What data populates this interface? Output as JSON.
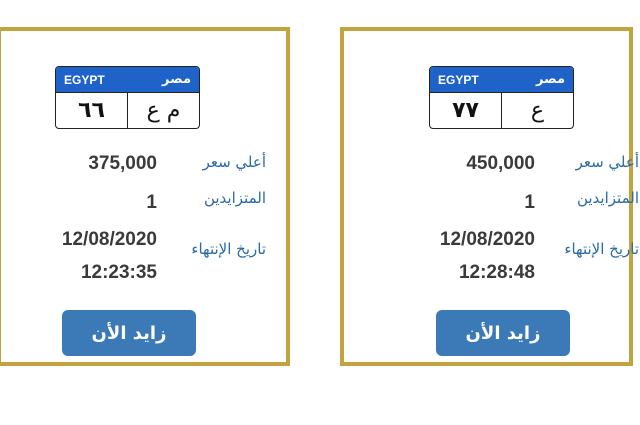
{
  "cards": [
    {
      "plate": {
        "country_en": "EGYPT",
        "country_ar": "مصر",
        "numbers": "٦٦",
        "letters": "م ع"
      },
      "highest_bid_label": "أعلي سعر",
      "highest_bid": "375,000",
      "bidders_label": "المتزايدين",
      "bidders": "1",
      "end_date_label": "تاريخ الإنتهاء",
      "end_date": "12/08/2020",
      "end_time": "12:23:35",
      "bid_button": "زايد الأن"
    },
    {
      "plate": {
        "country_en": "EGYPT",
        "country_ar": "مصر",
        "numbers": "٧٧",
        "letters": "ع"
      },
      "highest_bid_label": "أعلي سعر",
      "highest_bid": "450,000",
      "bidders_label": "المتزايدين",
      "bidders": "1",
      "end_date_label": "تاريخ الإنتهاء",
      "end_date": "12/08/2020",
      "end_time": "12:28:48",
      "bid_button": "زايد الأن"
    }
  ],
  "colors": {
    "border": "#c2a33d",
    "plate_header": "#1f63c8",
    "label": "#2a6aa6",
    "button": "#3b7ab6"
  }
}
